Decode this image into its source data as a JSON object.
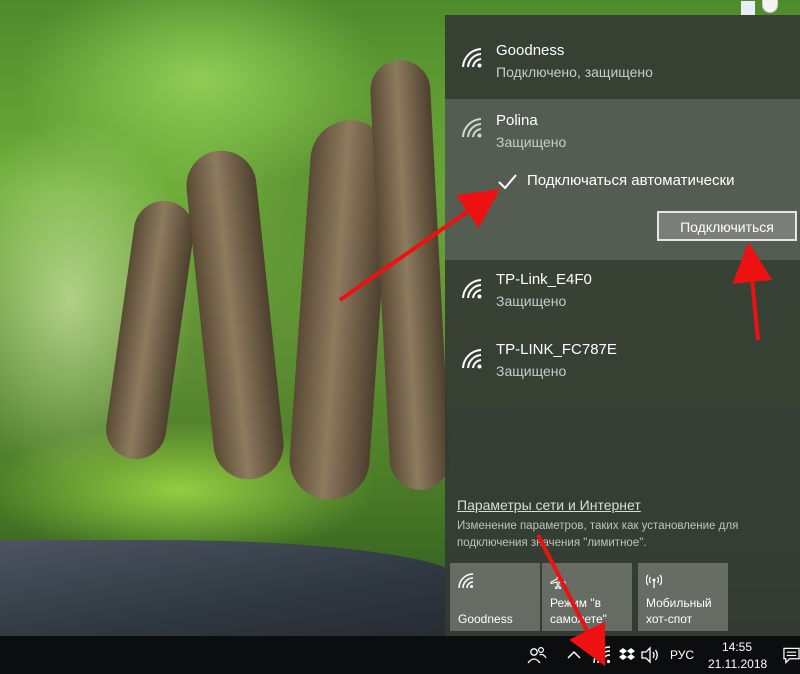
{
  "wifi_networks": [
    {
      "name": "Goodness",
      "status": "Подключено, защищено"
    },
    {
      "name": "Polina",
      "status": "Защищено"
    },
    {
      "name": "TP-Link_E4F0",
      "status": "Защищено"
    },
    {
      "name": "TP-LINK_FC787E",
      "status": "Защищено"
    }
  ],
  "selected_network": {
    "auto_connect_label": "Подключаться автоматически",
    "auto_connect_checked": true,
    "connect_button_label": "Подключиться"
  },
  "settings": {
    "link_text": "Параметры сети и Интернет",
    "description": "Изменение параметров, таких как установление для подключения значения \"лимитное\"."
  },
  "quick_actions": [
    {
      "label": "Goodness",
      "icon": "wifi-icon"
    },
    {
      "label": "Режим \"в самолете\"",
      "icon": "airplane-icon"
    },
    {
      "label": "Мобильный хот-спот",
      "icon": "hotspot-icon"
    }
  ],
  "taskbar": {
    "language": "РУС",
    "time": "14:55",
    "date": "21.11.2018"
  },
  "annotations": {
    "arrow_color": "#ee1111"
  }
}
